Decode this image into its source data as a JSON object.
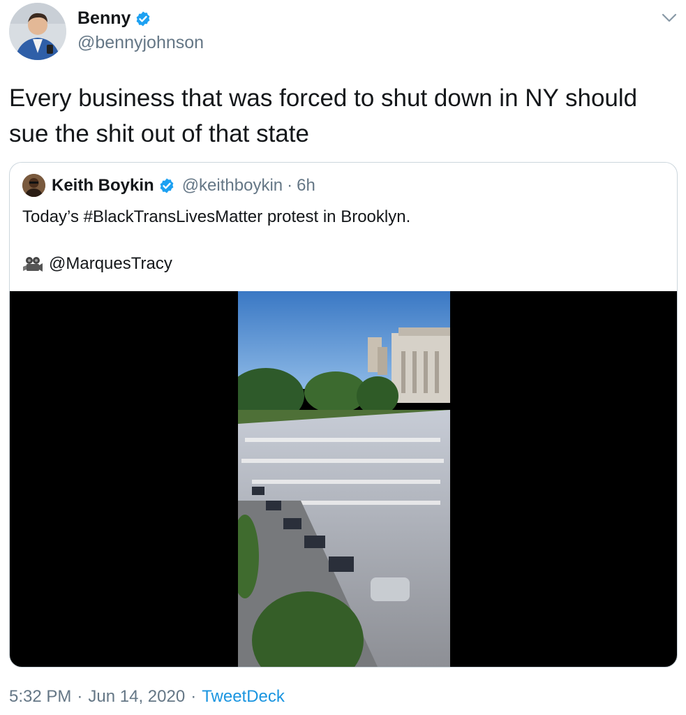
{
  "tweet": {
    "author": {
      "name": "Benny",
      "handle": "@bennyjohnson",
      "verified": true
    },
    "text": "Every business that was forced to shut down in NY should sue the shit out of that state",
    "menu_icon": "chevron-down-icon",
    "quoted": {
      "author_name": "Keith Boykin",
      "handle": "@keithboykin",
      "separator": "·",
      "time": "6h",
      "verified": true,
      "text": "Today’s #BlackTransLivesMatter protest in Brooklyn.",
      "credit_icon": "movie-camera-icon",
      "credit": "@MarquesTracy",
      "media": "video-thumbnail"
    },
    "footer": {
      "time": "5:32 PM",
      "sep1": "·",
      "date": "Jun 14, 2020",
      "sep2": "·",
      "source": "TweetDeck"
    }
  },
  "colors": {
    "text": "#14171a",
    "secondary": "#657786",
    "link": "#1b95e0",
    "verified": "#1da1f2",
    "card_border": "#ccd6dd"
  }
}
